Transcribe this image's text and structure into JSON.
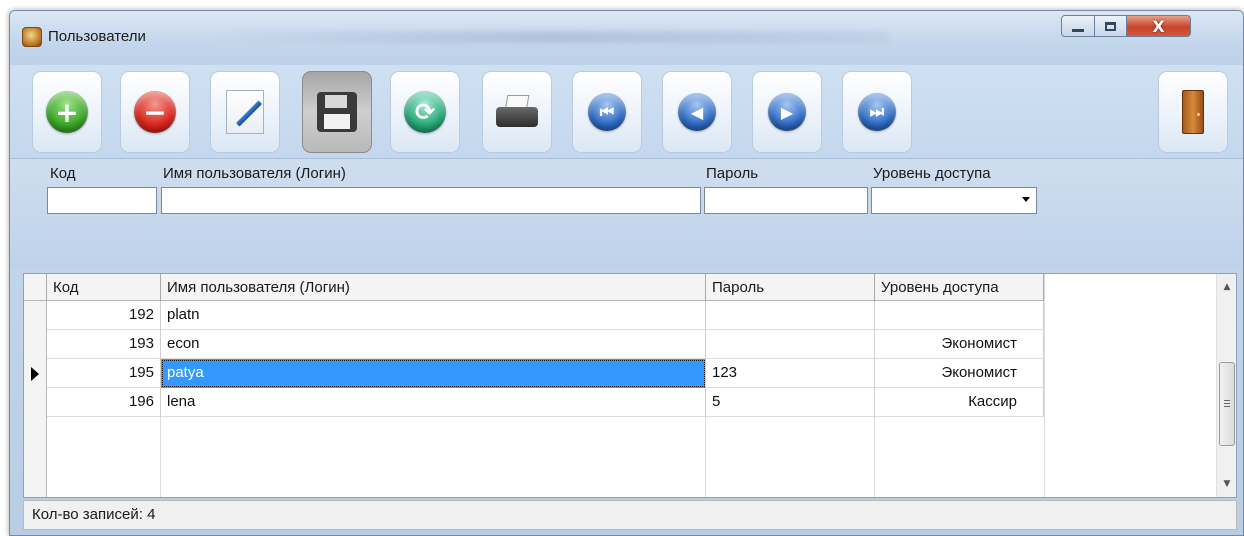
{
  "window": {
    "title": "Пользователи"
  },
  "toolbar": {
    "buttons": [
      {
        "name": "add",
        "icon": "add-icon",
        "glyph": "+"
      },
      {
        "name": "delete",
        "icon": "delete-icon",
        "glyph": "−"
      },
      {
        "name": "edit",
        "icon": "edit-icon"
      },
      {
        "name": "save",
        "icon": "save-icon"
      },
      {
        "name": "refresh",
        "icon": "refresh-icon",
        "glyph": "⟳"
      },
      {
        "name": "print",
        "icon": "printer-icon"
      },
      {
        "name": "first",
        "icon": "first-record-icon",
        "glyph": "⏮"
      },
      {
        "name": "prev",
        "icon": "previous-record-icon",
        "glyph": "◀"
      },
      {
        "name": "next",
        "icon": "next-record-icon",
        "glyph": "▶"
      },
      {
        "name": "last",
        "icon": "last-record-icon",
        "glyph": "⏭"
      },
      {
        "name": "exit",
        "icon": "door-exit-icon"
      }
    ]
  },
  "filter": {
    "labels": {
      "code": "Код",
      "login": "Имя пользователя (Логин)",
      "password": "Пароль",
      "access": "Уровень доступа"
    },
    "values": {
      "code": "",
      "login": "",
      "password": "",
      "access": ""
    }
  },
  "grid": {
    "columns": [
      "Код",
      "Имя пользователя (Логин)",
      "Пароль",
      "Уровень доступа"
    ],
    "rows": [
      {
        "code": "192",
        "login": "platn",
        "password": "",
        "access": ""
      },
      {
        "code": "193",
        "login": "econ",
        "password": "",
        "access": "Экономист"
      },
      {
        "code": "195",
        "login": "patya",
        "password": "123",
        "access": "Экономист"
      },
      {
        "code": "196",
        "login": "lena",
        "password": "5",
        "access": "Кассир"
      }
    ],
    "selected_row_index": 2
  },
  "status": {
    "text": "Кол-во записей: 4"
  },
  "colors": {
    "selection": "#3399ff",
    "window_frame": "#c9dbee",
    "close_button": "#c9442b"
  }
}
